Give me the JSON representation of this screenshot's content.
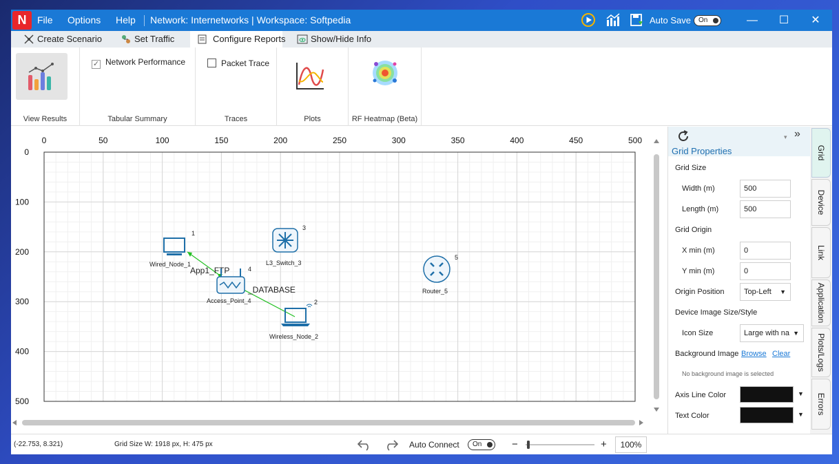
{
  "titlebar": {
    "menu": [
      "File",
      "Options",
      "Help"
    ],
    "title": "Network: Internetworks | Workspace: Softpedia",
    "autosave_label": "Auto Save",
    "autosave_state": "On",
    "app_logo": "N"
  },
  "tabs": [
    {
      "label": "Create Scenario",
      "icon": "scenario-icon"
    },
    {
      "label": "Set Traffic",
      "icon": "traffic-icon"
    },
    {
      "label": "Configure Reports",
      "icon": "report-icon",
      "active": true
    },
    {
      "label": "Show/Hide Info",
      "icon": "eye-icon"
    }
  ],
  "ribbon": {
    "view_results": "View Results",
    "network_performance": "Network Performance",
    "network_performance_checked": true,
    "tabular_summary": "Tabular Summary",
    "packet_trace": "Packet Trace",
    "packet_trace_checked": false,
    "traces": "Traces",
    "plots": "Plots",
    "rf_heatmap": "RF Heatmap (Beta)"
  },
  "canvas": {
    "x_ticks": [
      "0",
      "50",
      "100",
      "150",
      "200",
      "250",
      "300",
      "350",
      "400",
      "450",
      "500"
    ],
    "y_ticks": [
      "0",
      "100",
      "200",
      "300",
      "400",
      "500"
    ],
    "devices": [
      {
        "id": "1",
        "label": "Wired_Node_1",
        "icon": "desktop-icon"
      },
      {
        "id": "2",
        "label": "Wireless_Node_2",
        "icon": "laptop-icon"
      },
      {
        "id": "3",
        "label": "L3_Switch_3",
        "icon": "switch-icon"
      },
      {
        "id": "4",
        "label": "Access_Point_4",
        "icon": "access-point-icon"
      },
      {
        "id": "5",
        "label": "Router_5",
        "icon": "router-icon"
      }
    ],
    "app_labels": [
      "App1_FTP",
      "_DATABASE"
    ],
    "link_color": "#22c022"
  },
  "panel": {
    "title": "Grid Properties",
    "grid_size": "Grid Size",
    "width_label": "Width (m)",
    "width_value": "500",
    "length_label": "Length (m)",
    "length_value": "500",
    "grid_origin": "Grid Origin",
    "xmin_label": "X min (m)",
    "xmin_value": "0",
    "ymin_label": "Y min (m)",
    "ymin_value": "0",
    "origin_position_label": "Origin Position",
    "origin_position_value": "Top-Left",
    "device_image_label": "Device Image Size/Style",
    "icon_size_label": "Icon Size",
    "icon_size_value": "Large with na",
    "bg_image_label": "Background Image",
    "browse": "Browse",
    "clear": "Clear",
    "no_bg": "No background image is selected",
    "axis_line_color_label": "Axis Line Color",
    "text_color_label": "Text Color",
    "axis_line_color": "#111111",
    "text_color": "#111111"
  },
  "side_tabs": [
    "Grid",
    "Device",
    "Link",
    "Application",
    "Plots/Logs",
    "Errors"
  ],
  "status": {
    "coords": "(-22.753, 8.321)",
    "grid_size": "Grid Size W: 1918 px, H: 475 px",
    "auto_connect": "Auto Connect",
    "auto_connect_state": "On",
    "zoom": "100%",
    "minus": "−",
    "plus": "+"
  }
}
